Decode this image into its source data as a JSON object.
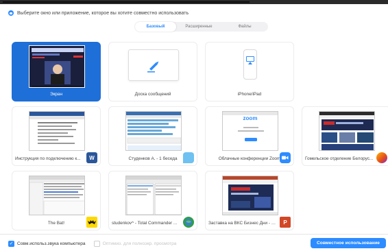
{
  "window": {
    "title": "Выберите окно или приложение, которое вы хотите совместно использовать"
  },
  "tabs": [
    {
      "label": "Базовый",
      "selected": true
    },
    {
      "label": "Расширенные",
      "selected": false
    },
    {
      "label": "Файлы",
      "selected": false
    }
  ],
  "tiles": [
    {
      "label": "Экран",
      "selected": true
    },
    {
      "label": "Доска сообщений"
    },
    {
      "label": "iPhone/iPad"
    },
    {
      "label": "Инструкция по подключению к...",
      "app_icon": "word-icon",
      "badge_text": "W"
    },
    {
      "label": "Студенков А. - 1 беседа",
      "app_icon": "chat-icon"
    },
    {
      "label": "Облачные конференции Zoom",
      "app_icon": "zoom-icon",
      "thumb_text": "zoom"
    },
    {
      "label": "Гомельское отделение Белорус...",
      "app_icon": "firefox-icon"
    },
    {
      "label": "The Bat!",
      "app_icon": "bat-icon"
    },
    {
      "label": "studenkov^ - Total Commander ...",
      "app_icon": "total-commander-icon"
    },
    {
      "label": "Заставка на ВКС Бизнес Дни - P...",
      "app_icon": "powerpoint-icon",
      "badge_text": "P"
    }
  ],
  "footer": {
    "sound_label": "Совм.использ.звука компьютера",
    "sound_checked": true,
    "optimize_label": "Оптимиз. для полноэкр. просмотра",
    "optimize_checked": false,
    "share_button": "Совместное использование"
  },
  "colors": {
    "accent": "#2d8cff",
    "selected_tile": "#1e6fd8"
  }
}
